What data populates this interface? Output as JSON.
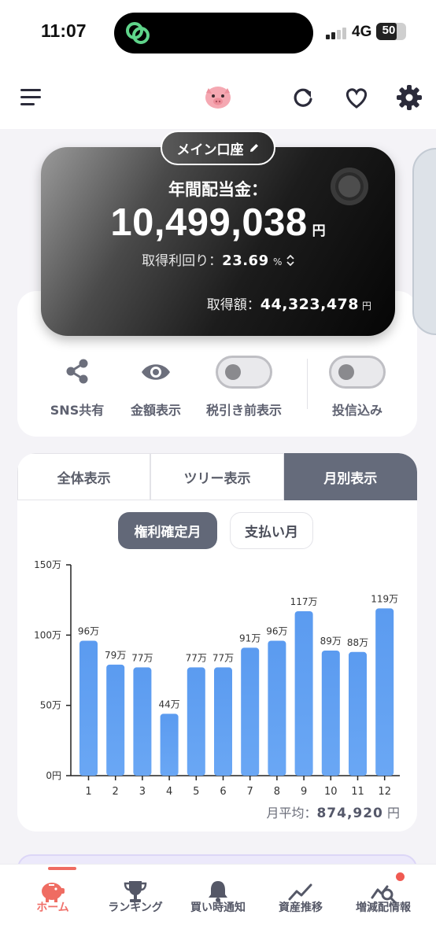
{
  "status_bar": {
    "time": "11:07",
    "network": "4G",
    "battery": "50"
  },
  "header": {
    "menu_icon": "hamburger-menu-icon",
    "logo_icon": "piggy-bank-icon",
    "actions": [
      "refresh-icon",
      "heart-icon",
      "gear-icon"
    ]
  },
  "account_card": {
    "account_name": "メイン口座",
    "title": "年間配当金：",
    "amount": "10,499,038",
    "amount_unit": "円",
    "yield_label": "取得利回り：",
    "yield_value": "23.69",
    "yield_unit": "%",
    "cost_label": "取得額：",
    "cost_value": "44,323,478",
    "cost_unit": "円"
  },
  "controls": {
    "share_label": "SNS共有",
    "show_amount_label": "金額表示",
    "pretax_label": "税引き前表示",
    "pretax_on": false,
    "fund_label": "投信込み",
    "fund_on": false
  },
  "view_tabs": [
    "全体表示",
    "ツリー表示",
    "月別表示"
  ],
  "active_tab": "月別表示",
  "month_mode": {
    "active": "権利確定月",
    "inactive": "支払い月"
  },
  "chart_data": {
    "type": "bar",
    "categories": [
      "1",
      "2",
      "3",
      "4",
      "5",
      "6",
      "7",
      "8",
      "9",
      "10",
      "11",
      "12"
    ],
    "values": [
      96,
      79,
      77,
      44,
      77,
      77,
      91,
      96,
      117,
      89,
      88,
      119
    ],
    "value_labels": [
      "96万",
      "79万",
      "77万",
      "44万",
      "77万",
      "77万",
      "91万",
      "96万",
      "117万",
      "89万",
      "88万",
      "119万"
    ],
    "y_ticks": [
      0,
      50,
      100,
      150
    ],
    "y_tick_labels": [
      "0円",
      "50万",
      "100万",
      "150万"
    ],
    "ylim": [
      0,
      150
    ],
    "bar_color": "#5b9bf0",
    "bar_color_light": "#6aa7f4",
    "title": "",
    "xlabel": "",
    "ylabel": ""
  },
  "monthly_average": {
    "label": "月平均：",
    "value": "874,920",
    "unit": "円"
  },
  "bottom_nav": [
    {
      "label": "ホーム",
      "icon": "piggy-bank-icon",
      "active": true
    },
    {
      "label": "ランキング",
      "icon": "trophy-icon",
      "active": false
    },
    {
      "label": "買い時通知",
      "icon": "bell-icon",
      "active": false
    },
    {
      "label": "資産推移",
      "icon": "trend-line-icon",
      "active": false
    },
    {
      "label": "増減配情報",
      "icon": "chart-search-icon",
      "active": false
    }
  ],
  "colors": {
    "accent": "#ef6c62",
    "tab_active": "#656b7b",
    "notification": "#f05a52"
  }
}
